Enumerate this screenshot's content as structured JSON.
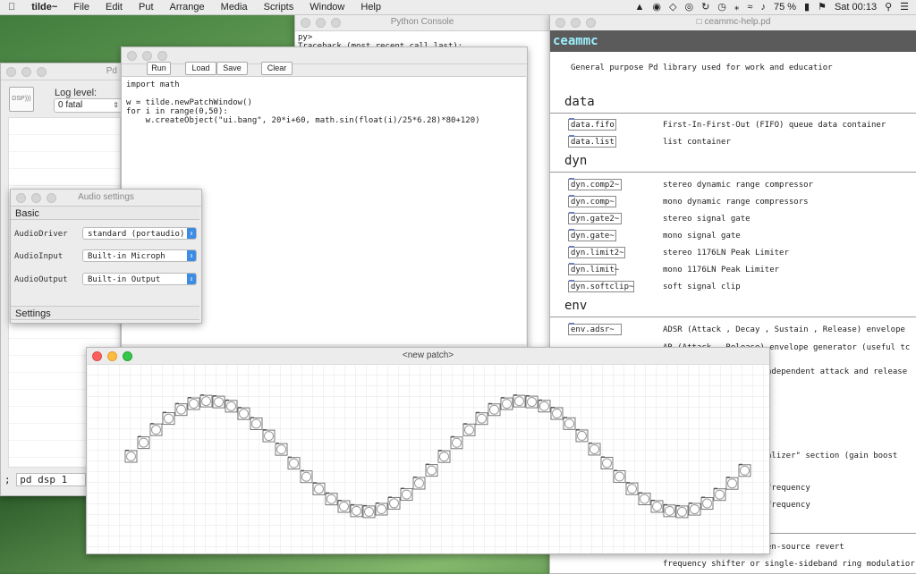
{
  "menubar": {
    "apple": "",
    "app": "tilde~",
    "items": [
      "File",
      "Edit",
      "Put",
      "Arrange",
      "Media",
      "Scripts",
      "Window",
      "Help"
    ],
    "battery": "75 %",
    "clock": "Sat 00:13"
  },
  "pd_main": {
    "title": "Pd",
    "dsp": "DSP",
    "log_label": "Log level:",
    "log_value": "0 fatal",
    "cmd_prefix": ";",
    "cmd_value": "pd dsp 1"
  },
  "python_console": {
    "title": "Python Console",
    "lines": [
      "py>",
      "Traceback (most recent call last):"
    ]
  },
  "editor": {
    "run": "Run",
    "load": "Load",
    "save": "Save",
    "clear": "Clear",
    "code": "import math\n\nw = tilde.newPatchWindow()\nfor i in range(0,50):\n    w.createObject(\"ui.bang\", 20*i+60, math.sin(float(i)/25*6.28)*80+120)"
  },
  "audio_settings": {
    "title": "Audio settings",
    "section_basic": "Basic",
    "rows": [
      {
        "label": "AudioDriver",
        "value": "standard (portaudio)"
      },
      {
        "label": "AudioInput",
        "value": "Built-in Microph"
      },
      {
        "label": "AudioOutput",
        "value": "Built-in Output"
      }
    ],
    "section_settings": "Settings"
  },
  "help": {
    "title": "ceammc-help.pd",
    "header": "ceammc",
    "description": "General purpose Pd library used for work and educatior",
    "sections": [
      {
        "name": "data",
        "items": [
          {
            "obj": "data.fifo",
            "desc": "First-In-First-Out (FIFO) queue data container"
          },
          {
            "obj": "data.list",
            "desc": "list container"
          }
        ]
      },
      {
        "name": "dyn",
        "items": [
          {
            "obj": "dyn.comp2~",
            "desc": "stereo dynamic range compressor"
          },
          {
            "obj": "dyn.comp~",
            "desc": "mono dynamic range compressors"
          },
          {
            "obj": "dyn.gate2~",
            "desc": "stereo signal gate"
          },
          {
            "obj": "dyn.gate~",
            "desc": "mono signal gate"
          },
          {
            "obj": "dyn.limit2~",
            "desc": "stereo 1176LN Peak Limiter"
          },
          {
            "obj": "dyn.limit~",
            "desc": "mono 1176LN Peak Limiter"
          },
          {
            "obj": "dyn.softclip~",
            "desc": "soft signal clip"
          }
        ]
      },
      {
        "name": "env",
        "items": [
          {
            "obj": "env.adsr~",
            "desc": "ADSR (Attack , Decay , Sustain , Release) envelope"
          }
        ]
      }
    ],
    "partial_lines": [
      "AR (Attack - Release) envelope generator (useful tc",
      "ndependent attack and release",
      "alizer\" section (gain boost",
      "frequency",
      "frequency",
      "en-source revert",
      "frequency shifter or single-sideband ring modulatior"
    ]
  },
  "patch": {
    "title": "<new patch>",
    "bang_count": 50
  }
}
